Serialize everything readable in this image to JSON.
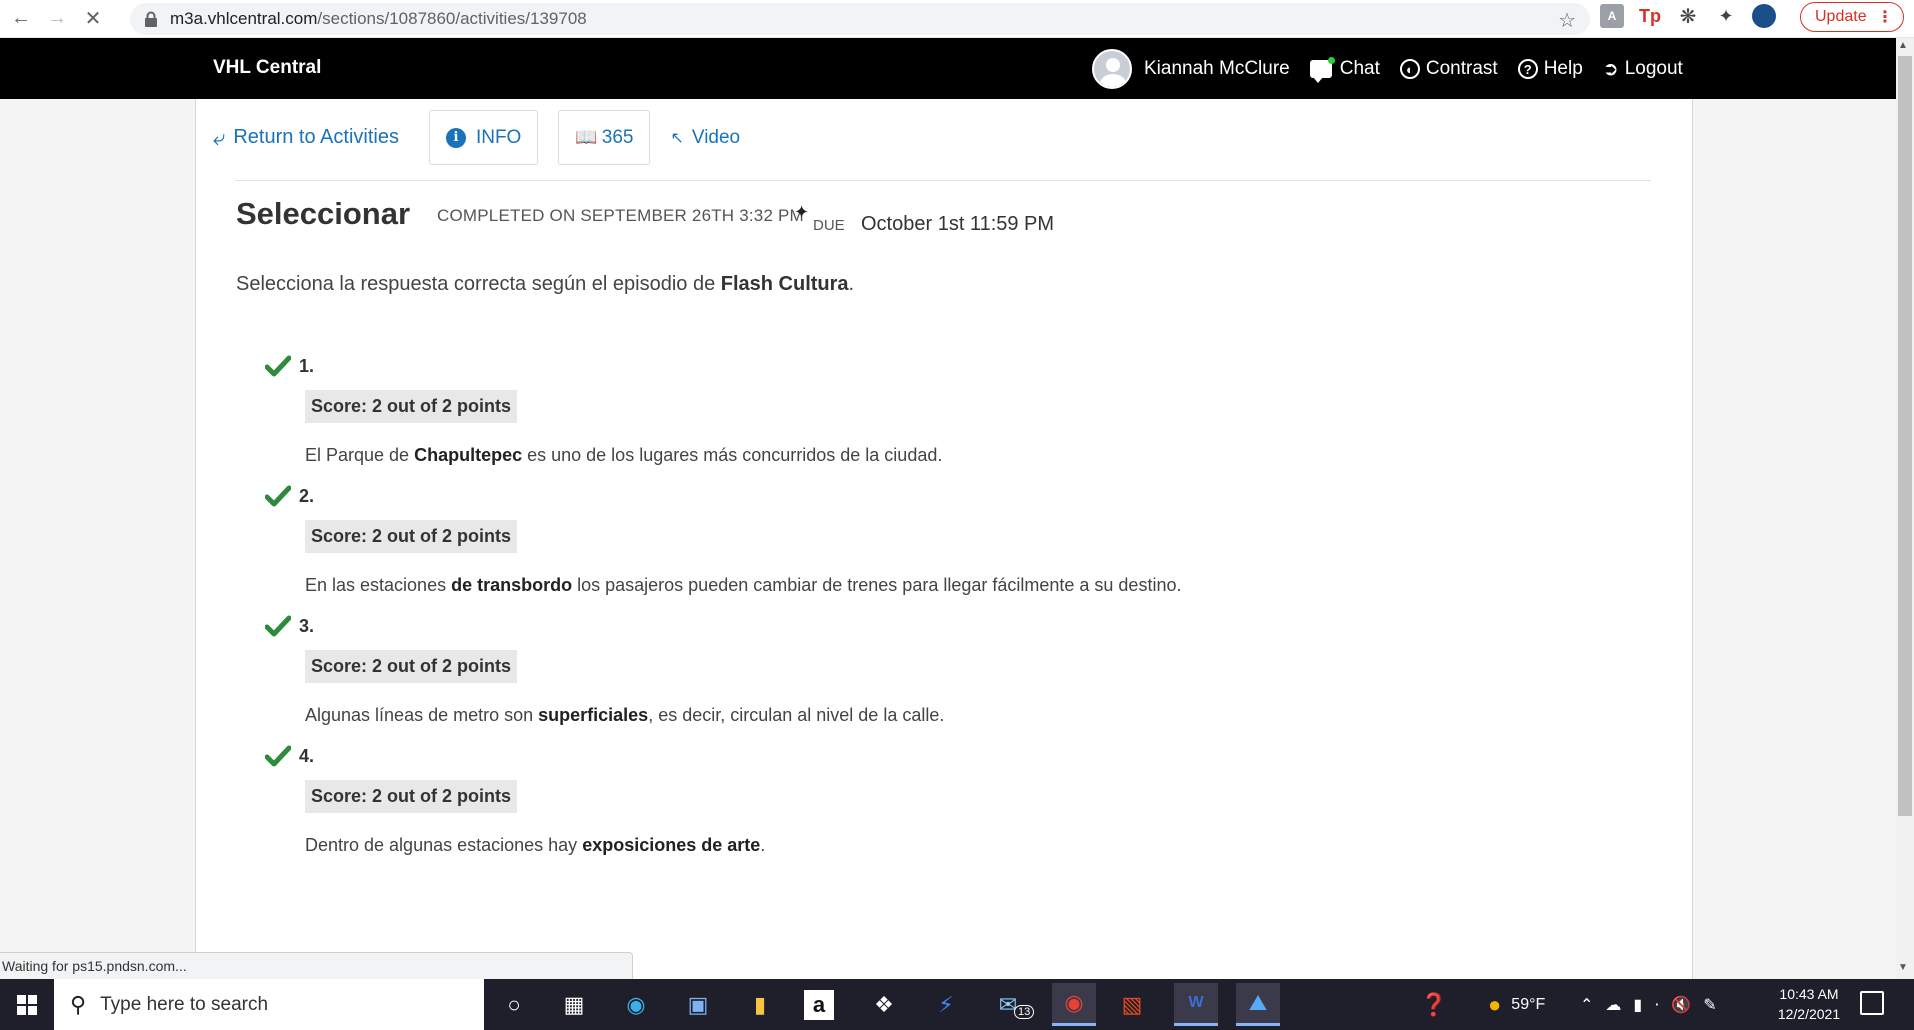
{
  "browser": {
    "url_domain": "m3a.vhlcentral.com",
    "url_path": "/sections/1087860/activities/139708",
    "update_label": "Update",
    "status_text": "Waiting for ps15.pndsn.com..."
  },
  "header": {
    "brand": "VHL Central",
    "user_name": "Kiannah McClure",
    "chat_label": "Chat",
    "contrast_label": "Contrast",
    "help_label": "Help",
    "logout_label": "Logout"
  },
  "toolbar": {
    "return_label": "Return to Activities",
    "info_label": "INFO",
    "page_label": "365",
    "video_label": "Video"
  },
  "activity": {
    "title": "Seleccionar",
    "completed": "COMPLETED ON SEPTEMBER 26TH 3:32 PM",
    "due_label": "DUE",
    "due_date": "October 1st 11:59 PM",
    "instructions_prefix": "Selecciona la respuesta correcta según el episodio de ",
    "instructions_bold": "Flash Cultura",
    "instructions_suffix": "."
  },
  "questions": [
    {
      "number": "1.",
      "score": "Score: 2 out of 2 points",
      "pre": "El Parque de ",
      "answer": "Chapultepec",
      "post": " es uno de los lugares más concurridos de la ciudad."
    },
    {
      "number": "2.",
      "score": "Score: 2 out of 2 points",
      "pre": "En las estaciones ",
      "answer": "de transbordo",
      "post": " los pasajeros pueden cambiar de trenes para llegar fácilmente a su destino."
    },
    {
      "number": "3.",
      "score": "Score: 2 out of 2 points",
      "pre": "Algunas líneas de metro son ",
      "answer": "superficiales",
      "post": ", es decir, circulan al nivel de la calle."
    },
    {
      "number": "4.",
      "score": "Score: 2 out of 2 points",
      "pre": "Dentro de algunas estaciones hay ",
      "answer": "exposiciones de arte",
      "post": "."
    }
  ],
  "taskbar": {
    "search_placeholder": "Type here to search",
    "mail_badge": "13",
    "weather": "59°F",
    "time": "10:43 AM",
    "date": "12/2/2021"
  },
  "colors": {
    "link": "#1a73b8",
    "check": "#2e8b3e",
    "header_bg": "#000000"
  }
}
